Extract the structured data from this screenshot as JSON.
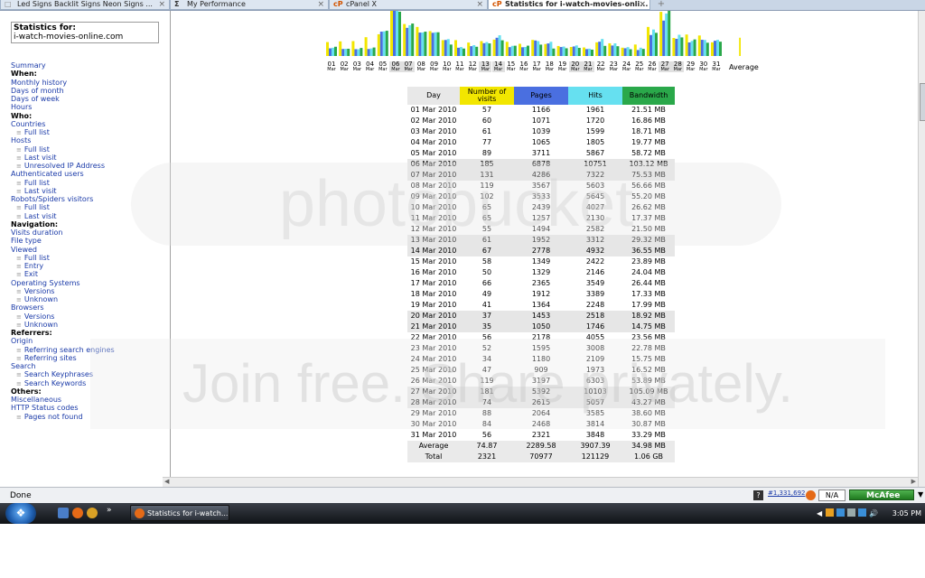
{
  "tabs": [
    {
      "label": "Led Signs Backlit Signs Neon Signs ...",
      "icon": "page-icon"
    },
    {
      "label": "My Performance",
      "icon": "sigma-icon"
    },
    {
      "label": "cPanel X",
      "icon": "cpanel-icon"
    },
    {
      "label": "Statistics for i-watch-movies-onli...",
      "icon": "cpanel-icon",
      "active": true
    }
  ],
  "sidebar": {
    "stats_for": "Statistics for:",
    "domain": "i-watch-movies-online.com",
    "menu": [
      {
        "label": "Summary",
        "type": "link"
      },
      {
        "label": "When:",
        "type": "head"
      },
      {
        "label": "Monthly history",
        "type": "link"
      },
      {
        "label": "Days of month",
        "type": "link"
      },
      {
        "label": "Days of week",
        "type": "link"
      },
      {
        "label": "Hours",
        "type": "link"
      },
      {
        "label": "Who:",
        "type": "head"
      },
      {
        "label": "Countries",
        "type": "link"
      },
      {
        "label": "Full list",
        "type": "sub"
      },
      {
        "label": "Hosts",
        "type": "link"
      },
      {
        "label": "Full list",
        "type": "sub"
      },
      {
        "label": "Last visit",
        "type": "sub"
      },
      {
        "label": "Unresolved IP Address",
        "type": "sub"
      },
      {
        "label": "Authenticated users",
        "type": "link"
      },
      {
        "label": "Full list",
        "type": "sub"
      },
      {
        "label": "Last visit",
        "type": "sub"
      },
      {
        "label": "Robots/Spiders visitors",
        "type": "link"
      },
      {
        "label": "Full list",
        "type": "sub"
      },
      {
        "label": "Last visit",
        "type": "sub"
      },
      {
        "label": "Navigation:",
        "type": "head"
      },
      {
        "label": "Visits duration",
        "type": "link"
      },
      {
        "label": "File type",
        "type": "link"
      },
      {
        "label": "Viewed",
        "type": "link"
      },
      {
        "label": "Full list",
        "type": "sub"
      },
      {
        "label": "Entry",
        "type": "sub"
      },
      {
        "label": "Exit",
        "type": "sub"
      },
      {
        "label": "Operating Systems",
        "type": "link"
      },
      {
        "label": "Versions",
        "type": "sub"
      },
      {
        "label": "Unknown",
        "type": "sub"
      },
      {
        "label": "Browsers",
        "type": "link"
      },
      {
        "label": "Versions",
        "type": "sub"
      },
      {
        "label": "Unknown",
        "type": "sub"
      },
      {
        "label": "Referrers:",
        "type": "head"
      },
      {
        "label": "Origin",
        "type": "link"
      },
      {
        "label": "Referring search engines",
        "type": "sub"
      },
      {
        "label": "Referring sites",
        "type": "sub"
      },
      {
        "label": "Search",
        "type": "link"
      },
      {
        "label": "Search Keyphrases",
        "type": "sub"
      },
      {
        "label": "Search Keywords",
        "type": "sub"
      },
      {
        "label": "Others:",
        "type": "head"
      },
      {
        "label": "Miscellaneous",
        "type": "link"
      },
      {
        "label": "HTTP Status codes",
        "type": "link"
      },
      {
        "label": "Pages not found",
        "type": "sub"
      }
    ]
  },
  "table": {
    "headers": {
      "day": "Day",
      "visits": "Number of visits",
      "pages": "Pages",
      "hits": "Hits",
      "bandwidth": "Bandwidth"
    },
    "header_colors": {
      "visits": "#f2e600",
      "pages": "#4a6fe0",
      "hits": "#66e0f0",
      "bandwidth": "#2aa84a"
    },
    "rows": [
      {
        "day": "01 Mar 2010",
        "visits": "57",
        "pages": "1166",
        "hits": "1961",
        "bw": "21.51 MB",
        "we": false
      },
      {
        "day": "02 Mar 2010",
        "visits": "60",
        "pages": "1071",
        "hits": "1720",
        "bw": "16.86 MB",
        "we": false
      },
      {
        "day": "03 Mar 2010",
        "visits": "61",
        "pages": "1039",
        "hits": "1599",
        "bw": "18.71 MB",
        "we": false
      },
      {
        "day": "04 Mar 2010",
        "visits": "77",
        "pages": "1065",
        "hits": "1805",
        "bw": "19.77 MB",
        "we": false
      },
      {
        "day": "05 Mar 2010",
        "visits": "89",
        "pages": "3711",
        "hits": "5867",
        "bw": "58.72 MB",
        "we": false
      },
      {
        "day": "06 Mar 2010",
        "visits": "185",
        "pages": "6878",
        "hits": "10751",
        "bw": "103.12 MB",
        "we": true
      },
      {
        "day": "07 Mar 2010",
        "visits": "131",
        "pages": "4286",
        "hits": "7322",
        "bw": "75.53 MB",
        "we": true
      },
      {
        "day": "08 Mar 2010",
        "visits": "119",
        "pages": "3567",
        "hits": "5603",
        "bw": "56.66 MB",
        "we": false
      },
      {
        "day": "09 Mar 2010",
        "visits": "102",
        "pages": "3533",
        "hits": "5645",
        "bw": "55.20 MB",
        "we": false
      },
      {
        "day": "10 Mar 2010",
        "visits": "65",
        "pages": "2439",
        "hits": "4027",
        "bw": "26.62 MB",
        "we": false
      },
      {
        "day": "11 Mar 2010",
        "visits": "65",
        "pages": "1257",
        "hits": "2130",
        "bw": "17.37 MB",
        "we": false
      },
      {
        "day": "12 Mar 2010",
        "visits": "55",
        "pages": "1494",
        "hits": "2582",
        "bw": "21.50 MB",
        "we": false
      },
      {
        "day": "13 Mar 2010",
        "visits": "61",
        "pages": "1952",
        "hits": "3312",
        "bw": "29.32 MB",
        "we": true
      },
      {
        "day": "14 Mar 2010",
        "visits": "67",
        "pages": "2778",
        "hits": "4932",
        "bw": "36.55 MB",
        "we": true
      },
      {
        "day": "15 Mar 2010",
        "visits": "58",
        "pages": "1349",
        "hits": "2422",
        "bw": "23.89 MB",
        "we": false
      },
      {
        "day": "16 Mar 2010",
        "visits": "50",
        "pages": "1329",
        "hits": "2146",
        "bw": "24.04 MB",
        "we": false
      },
      {
        "day": "17 Mar 2010",
        "visits": "66",
        "pages": "2365",
        "hits": "3549",
        "bw": "26.44 MB",
        "we": false
      },
      {
        "day": "18 Mar 2010",
        "visits": "49",
        "pages": "1912",
        "hits": "3389",
        "bw": "17.33 MB",
        "we": false
      },
      {
        "day": "19 Mar 2010",
        "visits": "41",
        "pages": "1364",
        "hits": "2248",
        "bw": "17.99 MB",
        "we": false
      },
      {
        "day": "20 Mar 2010",
        "visits": "37",
        "pages": "1453",
        "hits": "2518",
        "bw": "18.92 MB",
        "we": true
      },
      {
        "day": "21 Mar 2010",
        "visits": "35",
        "pages": "1050",
        "hits": "1746",
        "bw": "14.75 MB",
        "we": true
      },
      {
        "day": "22 Mar 2010",
        "visits": "56",
        "pages": "2178",
        "hits": "4055",
        "bw": "23.56 MB",
        "we": false
      },
      {
        "day": "23 Mar 2010",
        "visits": "52",
        "pages": "1595",
        "hits": "3008",
        "bw": "22.78 MB",
        "we": false
      },
      {
        "day": "24 Mar 2010",
        "visits": "34",
        "pages": "1180",
        "hits": "2109",
        "bw": "15.75 MB",
        "we": false
      },
      {
        "day": "25 Mar 2010",
        "visits": "47",
        "pages": "909",
        "hits": "1973",
        "bw": "16.52 MB",
        "we": false
      },
      {
        "day": "26 Mar 2010",
        "visits": "119",
        "pages": "3197",
        "hits": "6303",
        "bw": "53.89 MB",
        "we": false
      },
      {
        "day": "27 Mar 2010",
        "visits": "181",
        "pages": "5392",
        "hits": "10103",
        "bw": "105.09 MB",
        "we": true
      },
      {
        "day": "28 Mar 2010",
        "visits": "74",
        "pages": "2615",
        "hits": "5057",
        "bw": "43.27 MB",
        "we": true
      },
      {
        "day": "29 Mar 2010",
        "visits": "88",
        "pages": "2064",
        "hits": "3585",
        "bw": "38.60 MB",
        "we": false
      },
      {
        "day": "30 Mar 2010",
        "visits": "84",
        "pages": "2468",
        "hits": "3814",
        "bw": "30.87 MB",
        "we": false
      },
      {
        "day": "31 Mar 2010",
        "visits": "56",
        "pages": "2321",
        "hits": "3848",
        "bw": "33.29 MB",
        "we": false
      }
    ],
    "average": {
      "label": "Average",
      "visits": "74.87",
      "pages": "2289.58",
      "hits": "3907.39",
      "bw": "34.98 MB"
    },
    "total": {
      "label": "Total",
      "visits": "2321",
      "pages": "70977",
      "hits": "121129",
      "bw": "1.06 GB"
    }
  },
  "chart_data": {
    "type": "bar",
    "categories": [
      "01",
      "02",
      "03",
      "04",
      "05",
      "06",
      "07",
      "08",
      "09",
      "10",
      "11",
      "12",
      "13",
      "14",
      "15",
      "16",
      "17",
      "18",
      "19",
      "20",
      "21",
      "22",
      "23",
      "24",
      "25",
      "26",
      "27",
      "28",
      "29",
      "30",
      "31"
    ],
    "month_label": "Mar",
    "average_label": "Average",
    "weekend_days": [
      "06",
      "07",
      "13",
      "14",
      "20",
      "21",
      "27",
      "28"
    ],
    "series": [
      {
        "values": [
          57,
          60,
          61,
          77,
          89,
          185,
          131,
          119,
          102,
          65,
          65,
          55,
          61,
          67,
          58,
          50,
          66,
          49,
          41,
          37,
          35,
          56,
          52,
          34,
          47,
          119,
          181,
          74,
          88,
          84,
          56
        ],
        "color": "#f2e600"
      },
      {
        "values": [
          1166,
          1071,
          1039,
          1065,
          3711,
          6878,
          4286,
          3567,
          3533,
          2439,
          1257,
          1494,
          1952,
          2778,
          1349,
          1329,
          2365,
          1912,
          1364,
          1453,
          1050,
          2178,
          1595,
          1180,
          909,
          3197,
          5392,
          2615,
          2064,
          2468,
          2321
        ],
        "color": "#4a6fe0"
      },
      {
        "values": [
          1961,
          1720,
          1599,
          1805,
          5867,
          10751,
          7322,
          5603,
          5645,
          4027,
          2130,
          2582,
          3312,
          4932,
          2422,
          2146,
          3549,
          3389,
          2248,
          2518,
          1746,
          4055,
          3008,
          2109,
          1973,
          6303,
          10103,
          5057,
          3585,
          3814,
          3848
        ],
        "color": "#66e0f0"
      },
      {
        "values": [
          21.51,
          16.86,
          18.71,
          19.77,
          58.72,
          103.12,
          75.53,
          56.66,
          55.2,
          26.62,
          17.37,
          21.5,
          29.32,
          36.55,
          23.89,
          24.04,
          26.44,
          17.33,
          17.99,
          18.92,
          14.75,
          23.56,
          22.78,
          15.75,
          16.52,
          53.89,
          105.09,
          43.27,
          38.6,
          30.87,
          33.29
        ],
        "color": "#2aa84a"
      }
    ],
    "average": [
      74.87,
      2289.58,
      3907.39,
      34.98
    ]
  },
  "watermark": {
    "line1": "photobucket",
    "line2": "Join free. Share privately."
  },
  "statusbar": {
    "text": "Done",
    "rank": "#1,331,692",
    "na": "N/A",
    "mcafee": "McAfee"
  },
  "taskbar": {
    "window": "Statistics for i-watch...",
    "clock": "3:05 PM"
  }
}
